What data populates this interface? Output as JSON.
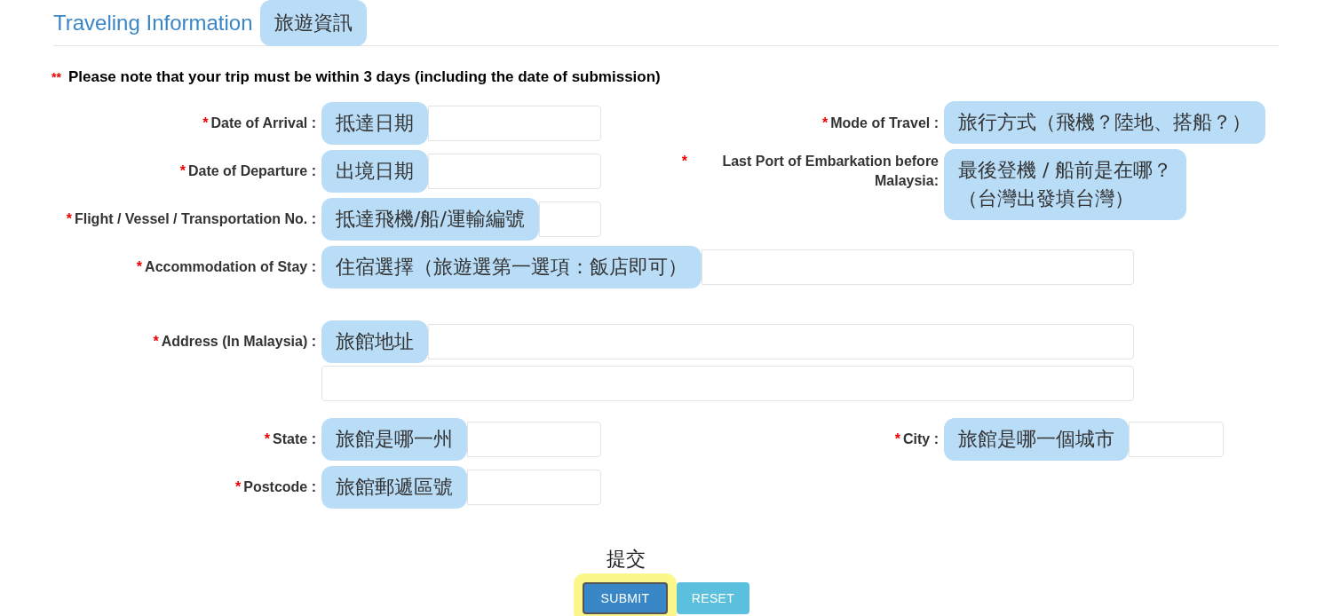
{
  "section": {
    "title": "Traveling Information",
    "annotation": "旅遊資訊"
  },
  "notice": {
    "mark": "**",
    "text": "Please note that your trip must be within 3 days (including the date of submission)"
  },
  "rows": [
    {
      "left": {
        "marker": "*",
        "label": "Date of Arrival :",
        "kind": "short",
        "annotation": [
          "抵達日期"
        ]
      },
      "right": {
        "marker": "*",
        "label": "Mode of Travel :",
        "kind": "covered",
        "annotation": [
          "旅行方式（飛機？陸地、搭船？）"
        ]
      }
    },
    {
      "left": {
        "marker": "*",
        "label": "Date of Departure :",
        "kind": "short",
        "annotation": [
          "出境日期"
        ]
      },
      "right": {
        "marker": "*",
        "label": "Last Port of Embarkation before Malaysia:",
        "kind": "covered",
        "annotation": [
          "最後登機 / 船前是在哪？",
          "（台灣出發填台灣）"
        ]
      }
    },
    {
      "left": {
        "marker": "*",
        "label": "Flight / Vessel / Transportation No. :",
        "kind": "short",
        "annotation": [
          "抵達飛機/船/運輸編號"
        ]
      }
    },
    {
      "left": {
        "marker": "*",
        "label": "Accommodation of Stay :",
        "kind": "wide",
        "annotation": [
          "住宿選擇（旅遊選第一選項：飯店即可）"
        ]
      }
    },
    {
      "left": {
        "marker": "*",
        "label": "Address (In Malaysia) :",
        "kind": "wide_two",
        "annotation": [
          "旅館地址"
        ]
      }
    },
    {
      "left": {
        "marker": "*",
        "label": "State :",
        "kind": "short",
        "annotation": [
          "旅館是哪一州"
        ]
      },
      "right": {
        "marker": "*",
        "label": "City :",
        "kind": "short",
        "annotation": [
          "旅館是哪一個城市"
        ]
      }
    },
    {
      "left": {
        "marker": "*",
        "label": "Postcode :",
        "kind": "short",
        "annotation": [
          "旅館郵遞區號"
        ]
      }
    }
  ],
  "actions": {
    "annotation": "提交",
    "buttons": [
      {
        "label": "SUBMIT",
        "kind": "primary",
        "highlighted": true
      },
      {
        "label": "RESET",
        "kind": "secondary",
        "highlighted": false
      }
    ]
  }
}
